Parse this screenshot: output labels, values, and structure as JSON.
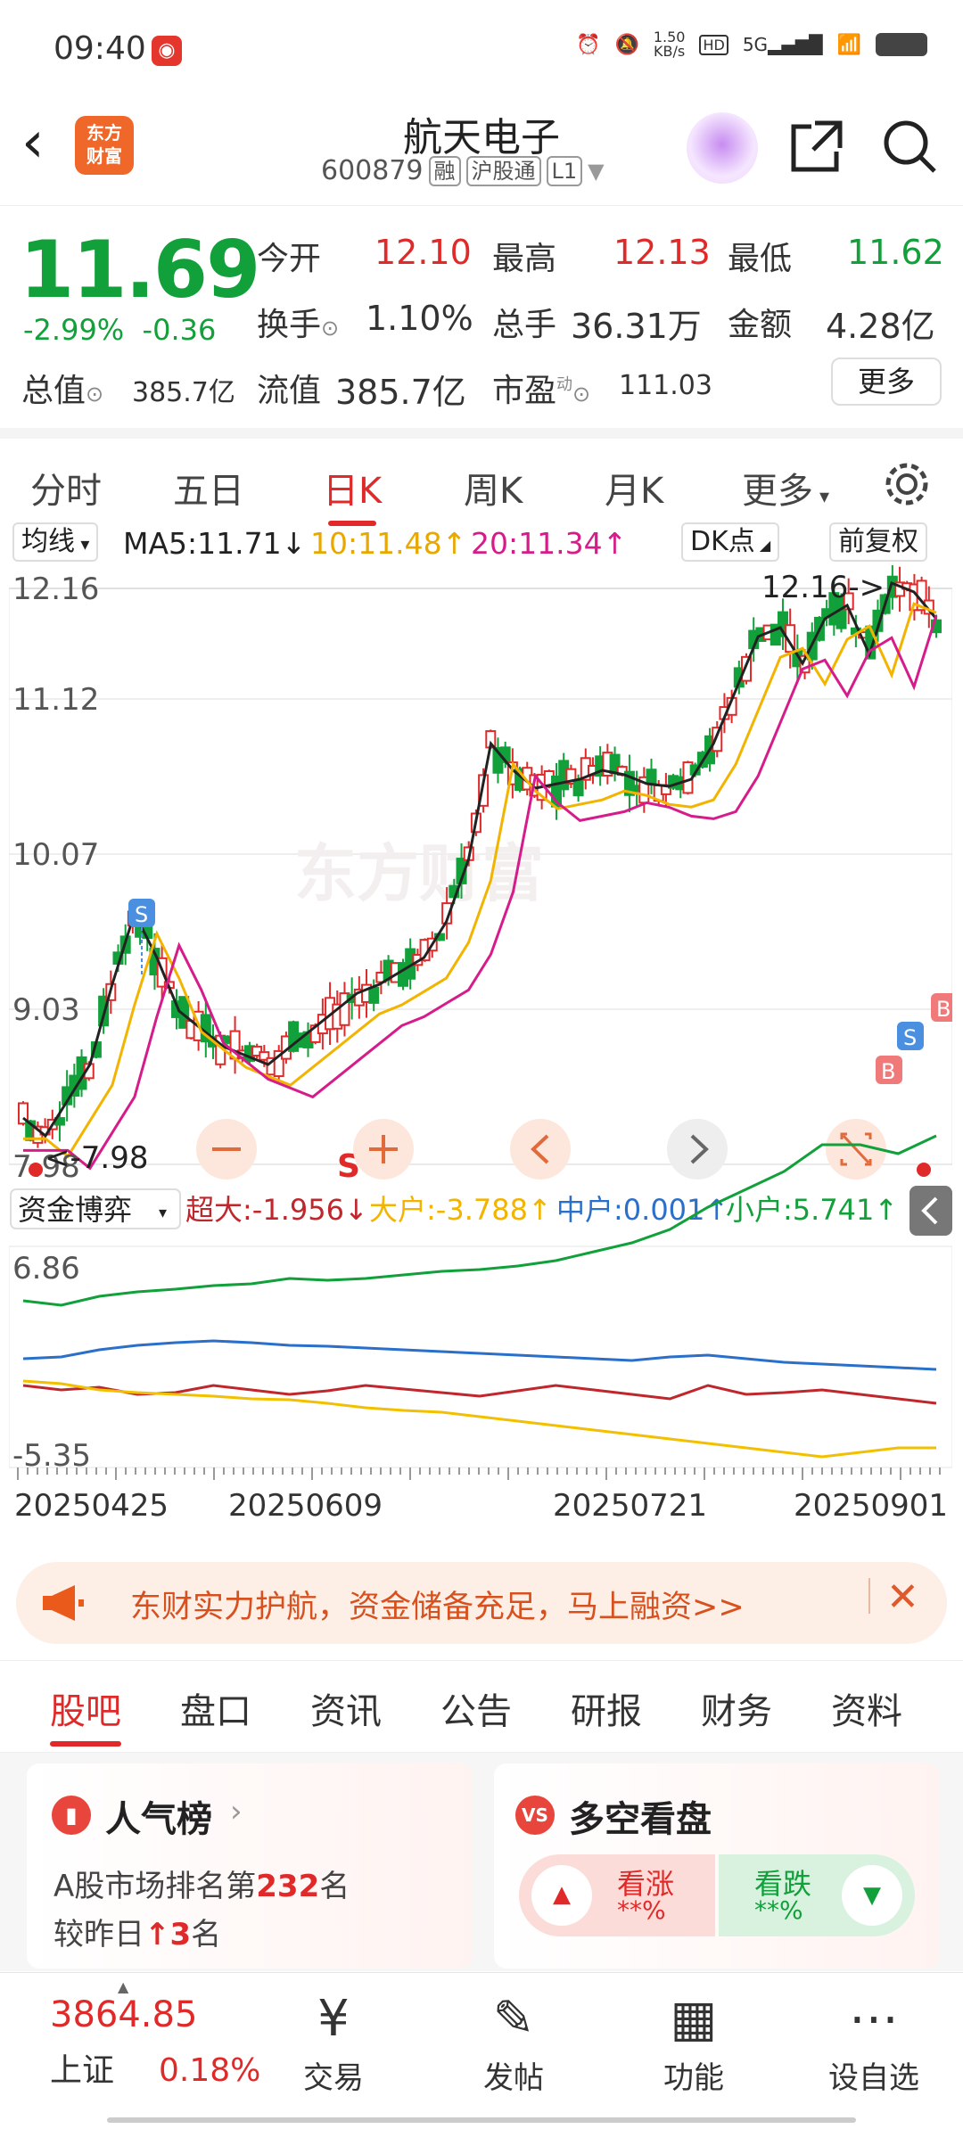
{
  "status": {
    "time": "09:40",
    "net_speed": "1.50\nKB/s",
    "net_speed_line1": "1.50",
    "net_speed_line2": "KB/s",
    "signal": "5G"
  },
  "header": {
    "logo_line1": "东方",
    "logo_line2": "财富",
    "stock_name": "航天电子",
    "stock_code": "600879",
    "tags": [
      "融",
      "沪股通",
      "L1"
    ]
  },
  "quote": {
    "price": "11.69",
    "change_pct": "-2.99%",
    "change_amt": "-0.36",
    "open_label": "今开",
    "open": "12.10",
    "high_label": "最高",
    "high": "12.13",
    "low_label": "最低",
    "low": "11.62",
    "turnover_label": "换手",
    "turnover": "1.10%",
    "volume_label": "总手",
    "volume": "36.31万",
    "amount_label": "金额",
    "amount": "4.28亿",
    "mktcap_label": "总值",
    "mktcap": "385.7亿",
    "float_label": "流值",
    "float": "385.7亿",
    "pe_label": "市盈",
    "pe_sup": "动",
    "pe": "111.03",
    "more": "更多"
  },
  "ktabs": [
    "分时",
    "五日",
    "日K",
    "周K",
    "月K",
    "更多"
  ],
  "ktab_active": 2,
  "ma": {
    "selector": "均线",
    "ma5": "MA5:11.71↓",
    "ma10": "10:11.48↑",
    "ma20": "20:11.34↑",
    "dk": "DK点",
    "adjust": "前复权"
  },
  "chart_labels": {
    "y_ticks": [
      "12.16",
      "11.12",
      "10.07",
      "9.03",
      "7.98"
    ],
    "max_note": "12.16->",
    "min_note": "<-7.98",
    "signal_s": "S",
    "signal_b": "B",
    "fund_selector": "资金博弈",
    "fund_super": "超大:-1.956↓",
    "fund_big": "大户:-3.788↑",
    "fund_mid": "中户:0.001↑",
    "fund_small": "小户:5.741↑",
    "fund_max": "6.86",
    "fund_min": "-5.35",
    "dates": [
      "20250425",
      "20250609",
      "20250721",
      "20250901"
    ]
  },
  "chart_data": {
    "type": "candlestick",
    "ylim": [
      7.98,
      12.16
    ],
    "ma_lines": [
      {
        "name": "MA5",
        "value": 11.71,
        "color": "#222222"
      },
      {
        "name": "MA10",
        "value": 11.48,
        "color": "#f2b400"
      },
      {
        "name": "MA20",
        "value": 11.34,
        "color": "#d61c8a"
      }
    ],
    "fund_flow_ylim": [
      -5.35,
      6.86
    ],
    "fund_flow": [
      {
        "name": "超大",
        "value": -1.956,
        "color": "#c0272d"
      },
      {
        "name": "大户",
        "value": -3.788,
        "color": "#f2c000"
      },
      {
        "name": "中户",
        "value": 0.001,
        "color": "#2a6fc9"
      },
      {
        "name": "小户",
        "value": 5.741,
        "color": "#11a03a"
      }
    ]
  },
  "ad": {
    "text": "东财实力护航，资金储备充足，马上融资>>"
  },
  "tabs2": [
    "股吧",
    "盘口",
    "资讯",
    "公告",
    "研报",
    "财务",
    "资料"
  ],
  "cards": {
    "rank_title": "人气榜",
    "rank_line1_pre": "A股市场排名第",
    "rank_num": "232",
    "rank_line1_post": "名",
    "rank_line2_pre": "较昨日",
    "rank_up": "3",
    "rank_line2_post": "名",
    "vote_title": "多空看盘",
    "bull": "看涨",
    "bull_pct": "**%",
    "bear": "看跌",
    "bear_pct": "**%"
  },
  "bottom": {
    "index_value": "3864.85",
    "index_name": "上证",
    "index_chg": "0.18%",
    "nav": [
      "交易",
      "发帖",
      "功能",
      "设自选"
    ]
  }
}
